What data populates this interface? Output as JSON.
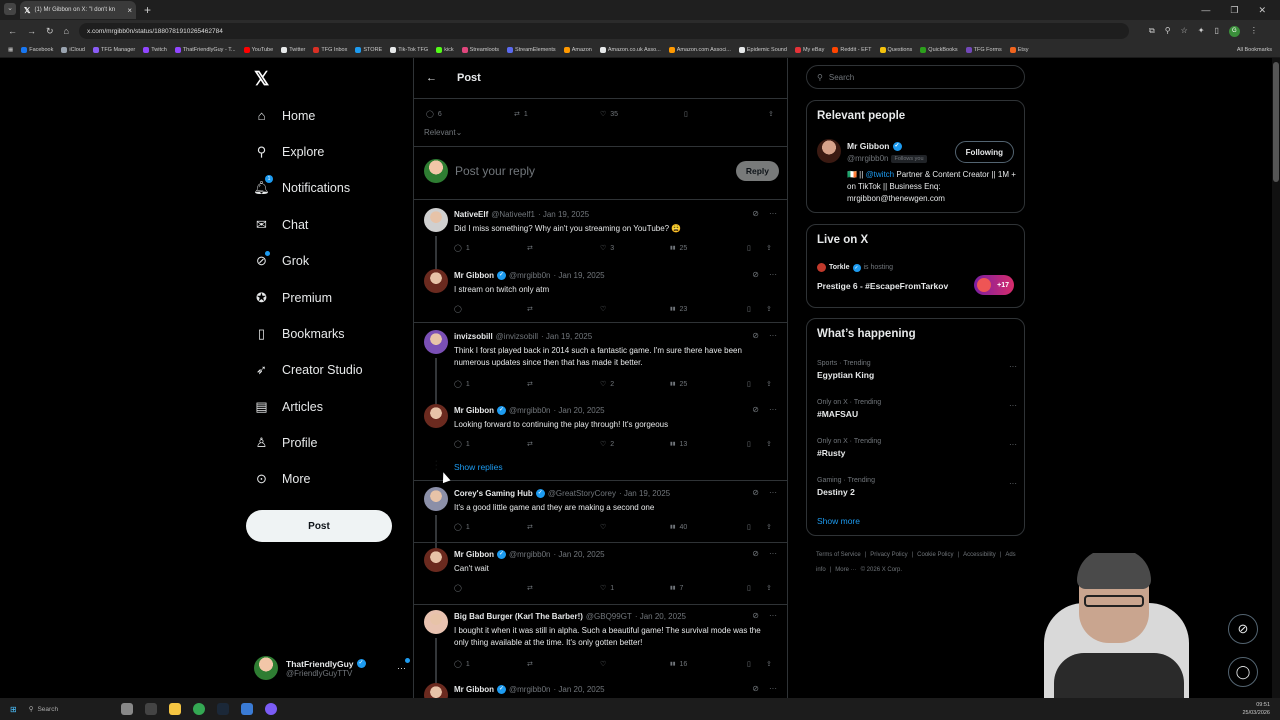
{
  "browser": {
    "tab_title": "(1) Mr Gibbon on X: \"I don't kn",
    "url": "x.com/mrgibb0n/status/1880781910265462784",
    "bookmarks": [
      {
        "label": "Facebook",
        "color": "#1877f2"
      },
      {
        "label": "iCloud",
        "color": "#9aa4b0"
      },
      {
        "label": "TFG Manager",
        "color": "#8a5cf6"
      },
      {
        "label": "Twitch",
        "color": "#9146ff"
      },
      {
        "label": "ThatFriendlyGuy - T...",
        "color": "#9146ff"
      },
      {
        "label": "YouTube",
        "color": "#ff0000"
      },
      {
        "label": "Twitter",
        "color": "#e7e9ea"
      },
      {
        "label": "TFG Inbox",
        "color": "#d93025"
      },
      {
        "label": "STORE",
        "color": "#1d9bf0"
      },
      {
        "label": "Tik-Tok TFG",
        "color": "#e7e9ea"
      },
      {
        "label": "kick",
        "color": "#53fc18"
      },
      {
        "label": "Streamloots",
        "color": "#e0467c"
      },
      {
        "label": "StreamElements",
        "color": "#5b6af0"
      },
      {
        "label": "Amazon",
        "color": "#ff9900"
      },
      {
        "label": "Amazon.co.uk Asso...",
        "color": "#e7e9ea"
      },
      {
        "label": "Amazon.com Associ...",
        "color": "#ff9900"
      },
      {
        "label": "Epidemic Sound",
        "color": "#e7e9ea"
      },
      {
        "label": "My eBay",
        "color": "#e53238"
      },
      {
        "label": "Reddit - EFT",
        "color": "#ff4500"
      },
      {
        "label": "Questions",
        "color": "#f4c20d"
      },
      {
        "label": "QuickBooks",
        "color": "#2ca01c"
      },
      {
        "label": "TFG Forms",
        "color": "#7248b9"
      },
      {
        "label": "Etsy",
        "color": "#f1641e"
      }
    ],
    "all_bookmarks": "All Bookmarks"
  },
  "nav": {
    "items": [
      {
        "label": "Home",
        "icon": "home-icon",
        "glyph": "⌂"
      },
      {
        "label": "Explore",
        "icon": "search-icon",
        "glyph": "⚲"
      },
      {
        "label": "Notifications",
        "icon": "bell-icon",
        "glyph": "🔔︎",
        "badge": "1"
      },
      {
        "label": "Chat",
        "icon": "mail-icon",
        "glyph": "✉"
      },
      {
        "label": "Grok",
        "icon": "grok-icon",
        "glyph": "⊘"
      },
      {
        "label": "Premium",
        "icon": "premium-icon",
        "glyph": "✪"
      },
      {
        "label": "Bookmarks",
        "icon": "bookmark-icon",
        "glyph": "▯"
      },
      {
        "label": "Creator Studio",
        "icon": "rocket-icon",
        "glyph": "➶"
      },
      {
        "label": "Articles",
        "icon": "articles-icon",
        "glyph": "▤"
      },
      {
        "label": "Profile",
        "icon": "profile-icon",
        "glyph": "♙"
      },
      {
        "label": "More",
        "icon": "more-icon",
        "glyph": "⊙"
      }
    ],
    "post_button": "Post",
    "account": {
      "name": "ThatFriendlyGuy",
      "handle": "@FriendlyGuyTTV"
    }
  },
  "main": {
    "back": "←",
    "title": "Post",
    "top_actions": {
      "replies": "6",
      "reposts": "1",
      "likes": "35"
    },
    "sort": "Relevant",
    "reply_placeholder": "Post your reply",
    "reply_button": "Reply",
    "show_replies": "Show replies",
    "tweets": [
      {
        "name": "NativeElf",
        "handle": "@Nativeelf1",
        "date": "· Jan 19, 2025",
        "verified": false,
        "text": "Did I miss something? Why ain't you streaming on YouTube? 😩",
        "replies": "1",
        "reposts": "",
        "likes": "3",
        "views": "25",
        "avatar": "#d0d0d0"
      },
      {
        "name": "Mr Gibbon",
        "handle": "@mrgibb0n",
        "date": "· Jan 19, 2025",
        "verified": true,
        "text": "I stream on twitch only atm",
        "replies": "",
        "reposts": "",
        "likes": "",
        "views": "23",
        "avatar": "#6b2a1f"
      },
      {
        "name": "invizsobill",
        "handle": "@invizsobill",
        "date": "· Jan 19, 2025",
        "verified": false,
        "text": "Think I forst played back in 2014 such a fantastic game. I'm sure there have been numerous updates since then that has made it better.",
        "replies": "1",
        "reposts": "",
        "likes": "2",
        "views": "25",
        "avatar": "#7a4fb5"
      },
      {
        "name": "Mr Gibbon",
        "handle": "@mrgibb0n",
        "date": "· Jan 20, 2025",
        "verified": true,
        "text": "Looking forward to continuing the play through! It's gorgeous",
        "replies": "1",
        "reposts": "",
        "likes": "2",
        "views": "13",
        "avatar": "#6b2a1f"
      },
      {
        "name": "Corey's Gaming Hub",
        "handle": "@GreatStoryCorey",
        "date": "· Jan 19, 2025",
        "verified": true,
        "text": "It's a good little game and they are making a second one",
        "replies": "1",
        "reposts": "",
        "likes": "",
        "views": "40",
        "avatar": "#8b8fa8"
      },
      {
        "name": "Mr Gibbon",
        "handle": "@mrgibb0n",
        "date": "· Jan 20, 2025",
        "verified": true,
        "text": "Can't wait",
        "replies": "",
        "reposts": "",
        "likes": "1",
        "views": "7",
        "avatar": "#6b2a1f"
      },
      {
        "name": "Big Bad Burger (Karl The Barber!)",
        "handle": "@GBQ99GT",
        "date": "· Jan 20, 2025",
        "verified": false,
        "text": "I bought it when it was still in alpha. Such a beautiful game! The survival mode was the only thing available at the time. It's only gotten better!",
        "replies": "1",
        "reposts": "",
        "likes": "",
        "views": "16",
        "avatar": "#e8c2b0"
      },
      {
        "name": "Mr Gibbon",
        "handle": "@mrgibb0n",
        "date": "· Jan 20, 2025",
        "verified": true,
        "text": "",
        "replies": "",
        "reposts": "",
        "likes": "",
        "views": "",
        "avatar": "#6b2a1f"
      }
    ]
  },
  "right": {
    "search_placeholder": "Search",
    "relevant": {
      "title": "Relevant people",
      "name": "Mr Gibbon",
      "handle": "@mrgibb0n",
      "follows_you": "Follows you",
      "follow_button": "Following",
      "bio_prefix": "🇮🇪 || ",
      "bio_link": "@twitch",
      "bio_rest": " Partner & Content Creator || 1M + on TikTok || Business Enq: mrgibbon@thenewgen.com"
    },
    "live": {
      "title": "Live on X",
      "host": "Torkle",
      "hosting": "is hosting",
      "stream_title": "Prestige 6 - #EscapeFromTarkov",
      "count": "+17"
    },
    "happening": {
      "title": "What’s happening",
      "trends": [
        {
          "context": "Sports · Trending",
          "topic": "Egyptian King"
        },
        {
          "context": "Only on X · Trending",
          "topic": "#MAFSAU"
        },
        {
          "context": "Only on X · Trending",
          "topic": "#Rusty"
        },
        {
          "context": "Gaming · Trending",
          "topic": "Destiny 2"
        }
      ],
      "show_more": "Show more"
    },
    "footer": [
      "Terms of Service",
      "|",
      "Privacy Policy",
      "|",
      "Cookie Policy",
      "|",
      "Accessibility",
      "|",
      "Ads info",
      "|",
      "More ···",
      "© 2026 X Corp."
    ]
  },
  "taskbar": {
    "search": "Search",
    "time": "09:51",
    "date": "25/03/2026"
  }
}
